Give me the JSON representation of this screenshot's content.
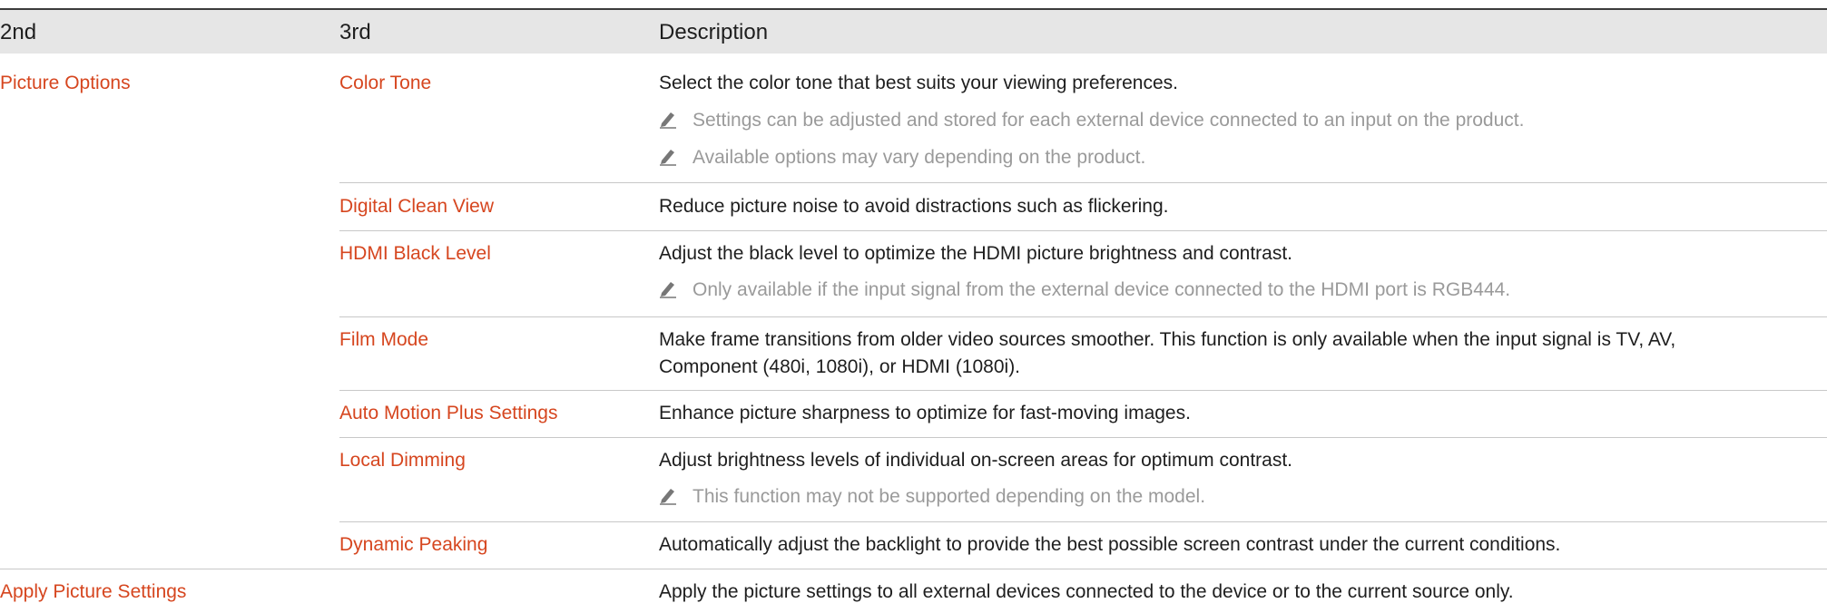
{
  "header": {
    "col1": "2nd",
    "col2": "3rd",
    "col3": "Description"
  },
  "rows": [
    {
      "second": "Picture Options",
      "third": "Color Tone",
      "desc": "Select the color tone that best suits your viewing preferences.",
      "notes": [
        "Settings can be adjusted and stored for each external device connected to an input on the product.",
        "Available options may vary depending on the product."
      ]
    },
    {
      "third": "Digital Clean View",
      "desc": "Reduce picture noise to avoid distractions such as flickering."
    },
    {
      "third": "HDMI Black Level",
      "desc": "Adjust the black level to optimize the HDMI picture brightness and contrast.",
      "notes": [
        "Only available if the input signal from the external device connected to the HDMI port is RGB444."
      ]
    },
    {
      "third": "Film Mode",
      "desc_lines": [
        "Make frame transitions from older video sources smoother. This function is only available when the input signal is TV, AV,",
        "Component (480i, 1080i), or HDMI (1080i)."
      ]
    },
    {
      "third": "Auto Motion Plus Settings",
      "desc": "Enhance picture sharpness to optimize for fast-moving images."
    },
    {
      "third": "Local Dimming",
      "desc": "Adjust brightness levels of individual on-screen areas for optimum contrast.",
      "notes": [
        "This function may not be supported depending on the model."
      ]
    },
    {
      "third": "Dynamic Peaking",
      "desc": "Automatically adjust the backlight to provide the best possible screen contrast under the current conditions."
    },
    {
      "second": "Apply Picture Settings",
      "desc": "Apply the picture settings to all external devices connected to the device or to the current source only."
    }
  ]
}
